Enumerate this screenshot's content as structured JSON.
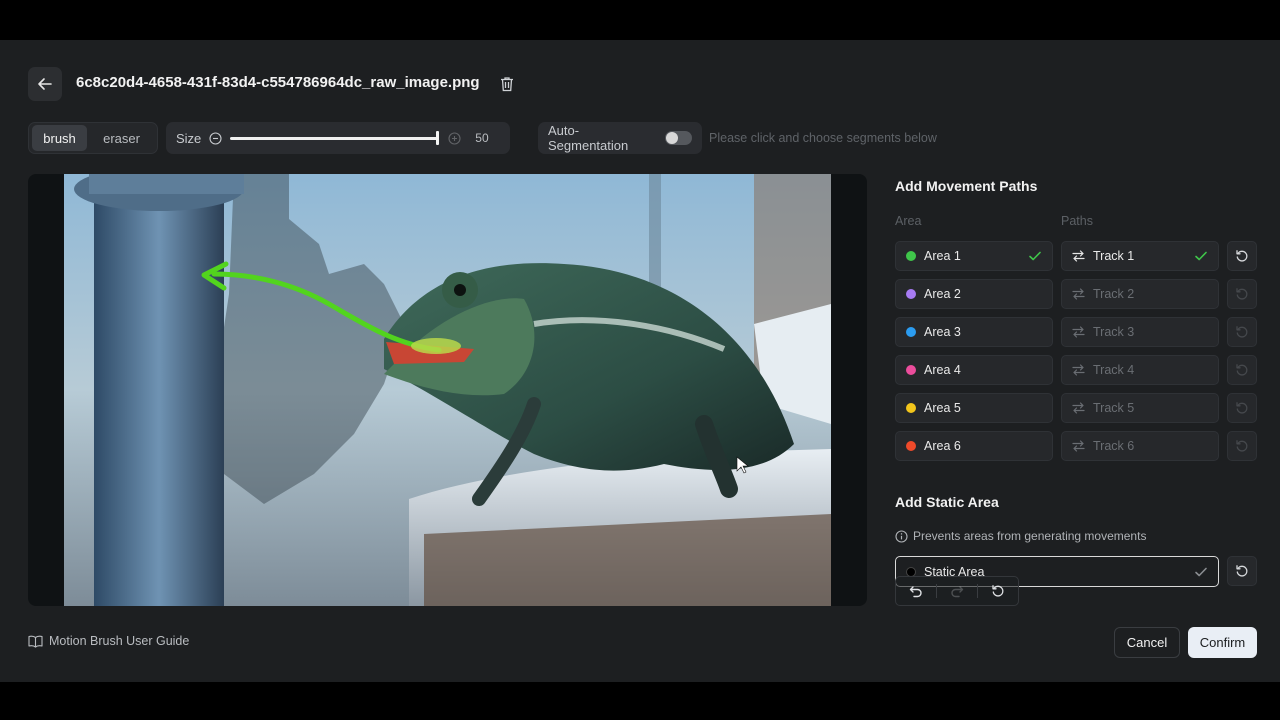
{
  "header": {
    "file_name": "6c8c20d4-4658-431f-83d4-c554786964dc_raw_image.png",
    "icons": {
      "back": "arrow-left-icon",
      "delete": "trash-icon"
    }
  },
  "toolbar": {
    "brush_label": "brush",
    "eraser_label": "eraser",
    "active_mode": "brush",
    "size_label": "Size",
    "size_value": "50",
    "size_fraction": 1.0,
    "autoseg_label": "Auto-Segmentation",
    "autoseg_on": false,
    "autoseg_hint": "Please click and choose segments below"
  },
  "movement": {
    "title": "Add Movement Paths",
    "area_header": "Area",
    "paths_header": "Paths",
    "rows": [
      {
        "area": "Area 1",
        "color": "#3fc54a",
        "track": "Track 1",
        "area_done": true,
        "track_done": true
      },
      {
        "area": "Area 2",
        "color": "#a77bf3",
        "track": "Track 2",
        "area_done": false,
        "track_done": false
      },
      {
        "area": "Area 3",
        "color": "#2b9cf0",
        "track": "Track 3",
        "area_done": false,
        "track_done": false
      },
      {
        "area": "Area 4",
        "color": "#ec4d9c",
        "track": "Track 4",
        "area_done": false,
        "track_done": false
      },
      {
        "area": "Area 5",
        "color": "#f2c51b",
        "track": "Track 5",
        "area_done": false,
        "track_done": false
      },
      {
        "area": "Area 6",
        "color": "#ef4a2a",
        "track": "Track 6",
        "area_done": false,
        "track_done": false
      }
    ]
  },
  "static": {
    "title": "Add Static Area",
    "hint": "Prevents areas from generating movements",
    "label": "Static Area",
    "color": "#000000"
  },
  "footer": {
    "guide_label": "Motion Brush User Guide",
    "cancel_label": "Cancel",
    "confirm_label": "Confirm"
  },
  "colors": {
    "accent_check": "#3fc54a",
    "path_arrow": "#52d41e"
  }
}
